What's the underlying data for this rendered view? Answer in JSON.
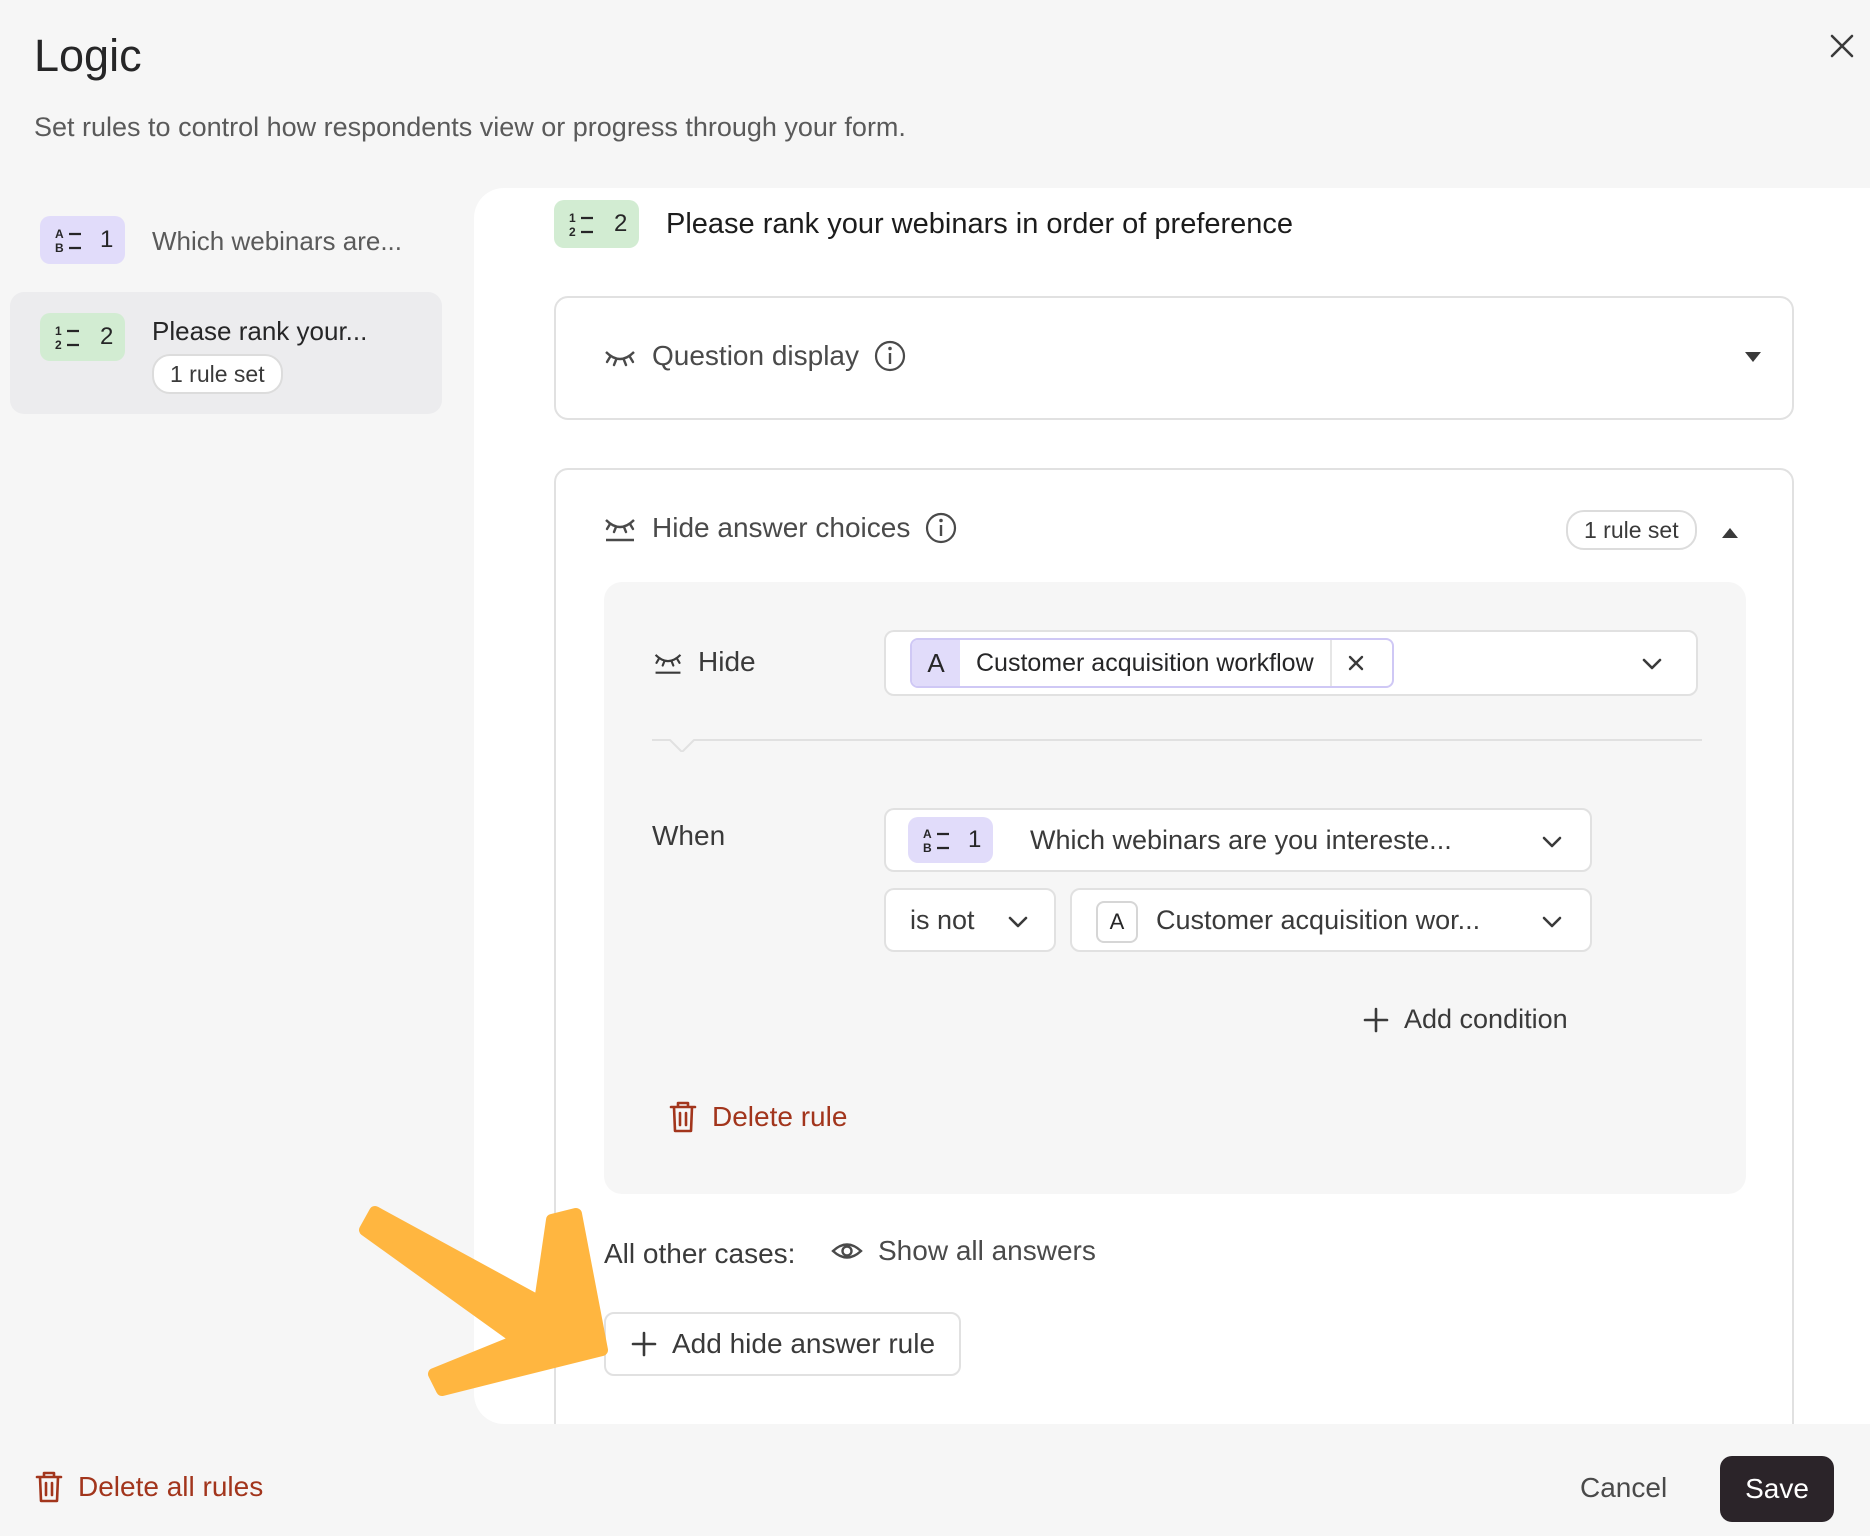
{
  "dialog": {
    "title": "Logic",
    "subtitle": "Set rules to control how respondents view or progress through your form."
  },
  "sidebar": {
    "items": [
      {
        "number": "1",
        "label": "Which webinars are...",
        "icon": "multiple-choice-icon"
      },
      {
        "number": "2",
        "label": "Please rank your...",
        "icon": "ranking-icon",
        "badge": "1 rule set"
      }
    ]
  },
  "question": {
    "number": "2",
    "title": "Please rank your webinars in order of preference"
  },
  "question_display": {
    "label": "Question display"
  },
  "hide_answer_choices": {
    "label": "Hide answer choices",
    "badge": "1 rule set",
    "rule": {
      "action_label": "Hide",
      "tag_letter": "A",
      "tag_label": "Customer acquisition workflow",
      "when_label": "When",
      "condition_question_number": "1",
      "condition_question": "Which webinars are you intereste...",
      "operator": "is not",
      "value_letter": "A",
      "value": "Customer acquisition wor...",
      "add_condition": "Add condition",
      "delete_rule": "Delete rule"
    },
    "other_cases_label": "All other cases:",
    "other_cases_value": "Show all answers",
    "add_rule": "Add hide answer rule"
  },
  "footer": {
    "delete_all": "Delete all rules",
    "cancel": "Cancel",
    "save": "Save"
  },
  "colors": {
    "accent_dark": "#2b2429",
    "danger": "#a2351c",
    "purple_badge": "#e1dcfa",
    "green_badge": "#d2ecd2",
    "arrow": "#ffb640"
  }
}
